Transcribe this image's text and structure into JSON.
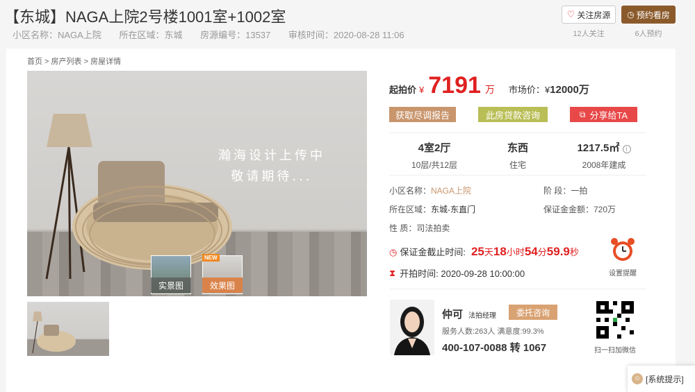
{
  "header": {
    "title": "【东城】NAGA上院2号楼1001室+1002室",
    "meta": {
      "community": "小区名称：NAGA上院",
      "area": "所在区域：东城",
      "listing_no": "房源编号：13537",
      "review_time": "审核时间：2020-08-28 11:06"
    },
    "follow_label": "关注房源",
    "follow_count": "12人关注",
    "book_label": "预约看房",
    "book_count": "6人预约"
  },
  "breadcrumb": "首页 > 房产列表 > 房屋详情",
  "gallery": {
    "watermark_line1": "瀚海设计上传中",
    "watermark_line2": "敬请期待...",
    "real_label": "实景图",
    "effect_label": "效果图",
    "new_badge": "NEW"
  },
  "price": {
    "label": "起拍价",
    "currency": "¥",
    "value": "7191",
    "unit": "万",
    "market_label": "市场价：",
    "market_currency": "¥",
    "market_value": "12000万"
  },
  "actions": {
    "report": "获取尽调报告",
    "loan": "此房贷款咨询",
    "share": "分享给TA"
  },
  "specs": [
    {
      "big": "4室2厅",
      "small": "10层/共12层"
    },
    {
      "big": "东西",
      "small": "住宅"
    },
    {
      "big": "1217.5㎡",
      "small": "2008年建成"
    }
  ],
  "info": {
    "community_label": "小区名称：",
    "community_value": "NAGA上院",
    "stage": "阶 段：一拍",
    "area_label": "所在区域：",
    "area_value": "东城-东直门",
    "deposit": "保证金金额：720万",
    "nature": "性 质：司法拍卖"
  },
  "countdown": {
    "label": "保证金截止时间:",
    "days": "25",
    "days_u": "天",
    "hours": "18",
    "hours_u": "小时",
    "minutes": "54",
    "minutes_u": "分",
    "seconds": "59.9",
    "seconds_u": "秒"
  },
  "start_time": "开拍时间:  2020-09-28 10:00:00",
  "alarm_label": "设置提醒",
  "agent": {
    "name": "仲可",
    "role": "法拍经理",
    "consult": "委托咨询",
    "stats": "服务人数:263人   满意度:99.3%",
    "phone": "400-107-0088 转 1067",
    "qr_label": "扫一扫加微信"
  },
  "system_tip": "[系统提示]",
  "colors": {
    "accent_red": "#e02020",
    "brown": "#8b5a2b",
    "tan": "#c8956c",
    "olive": "#b9be56",
    "share_red": "#e84848"
  }
}
